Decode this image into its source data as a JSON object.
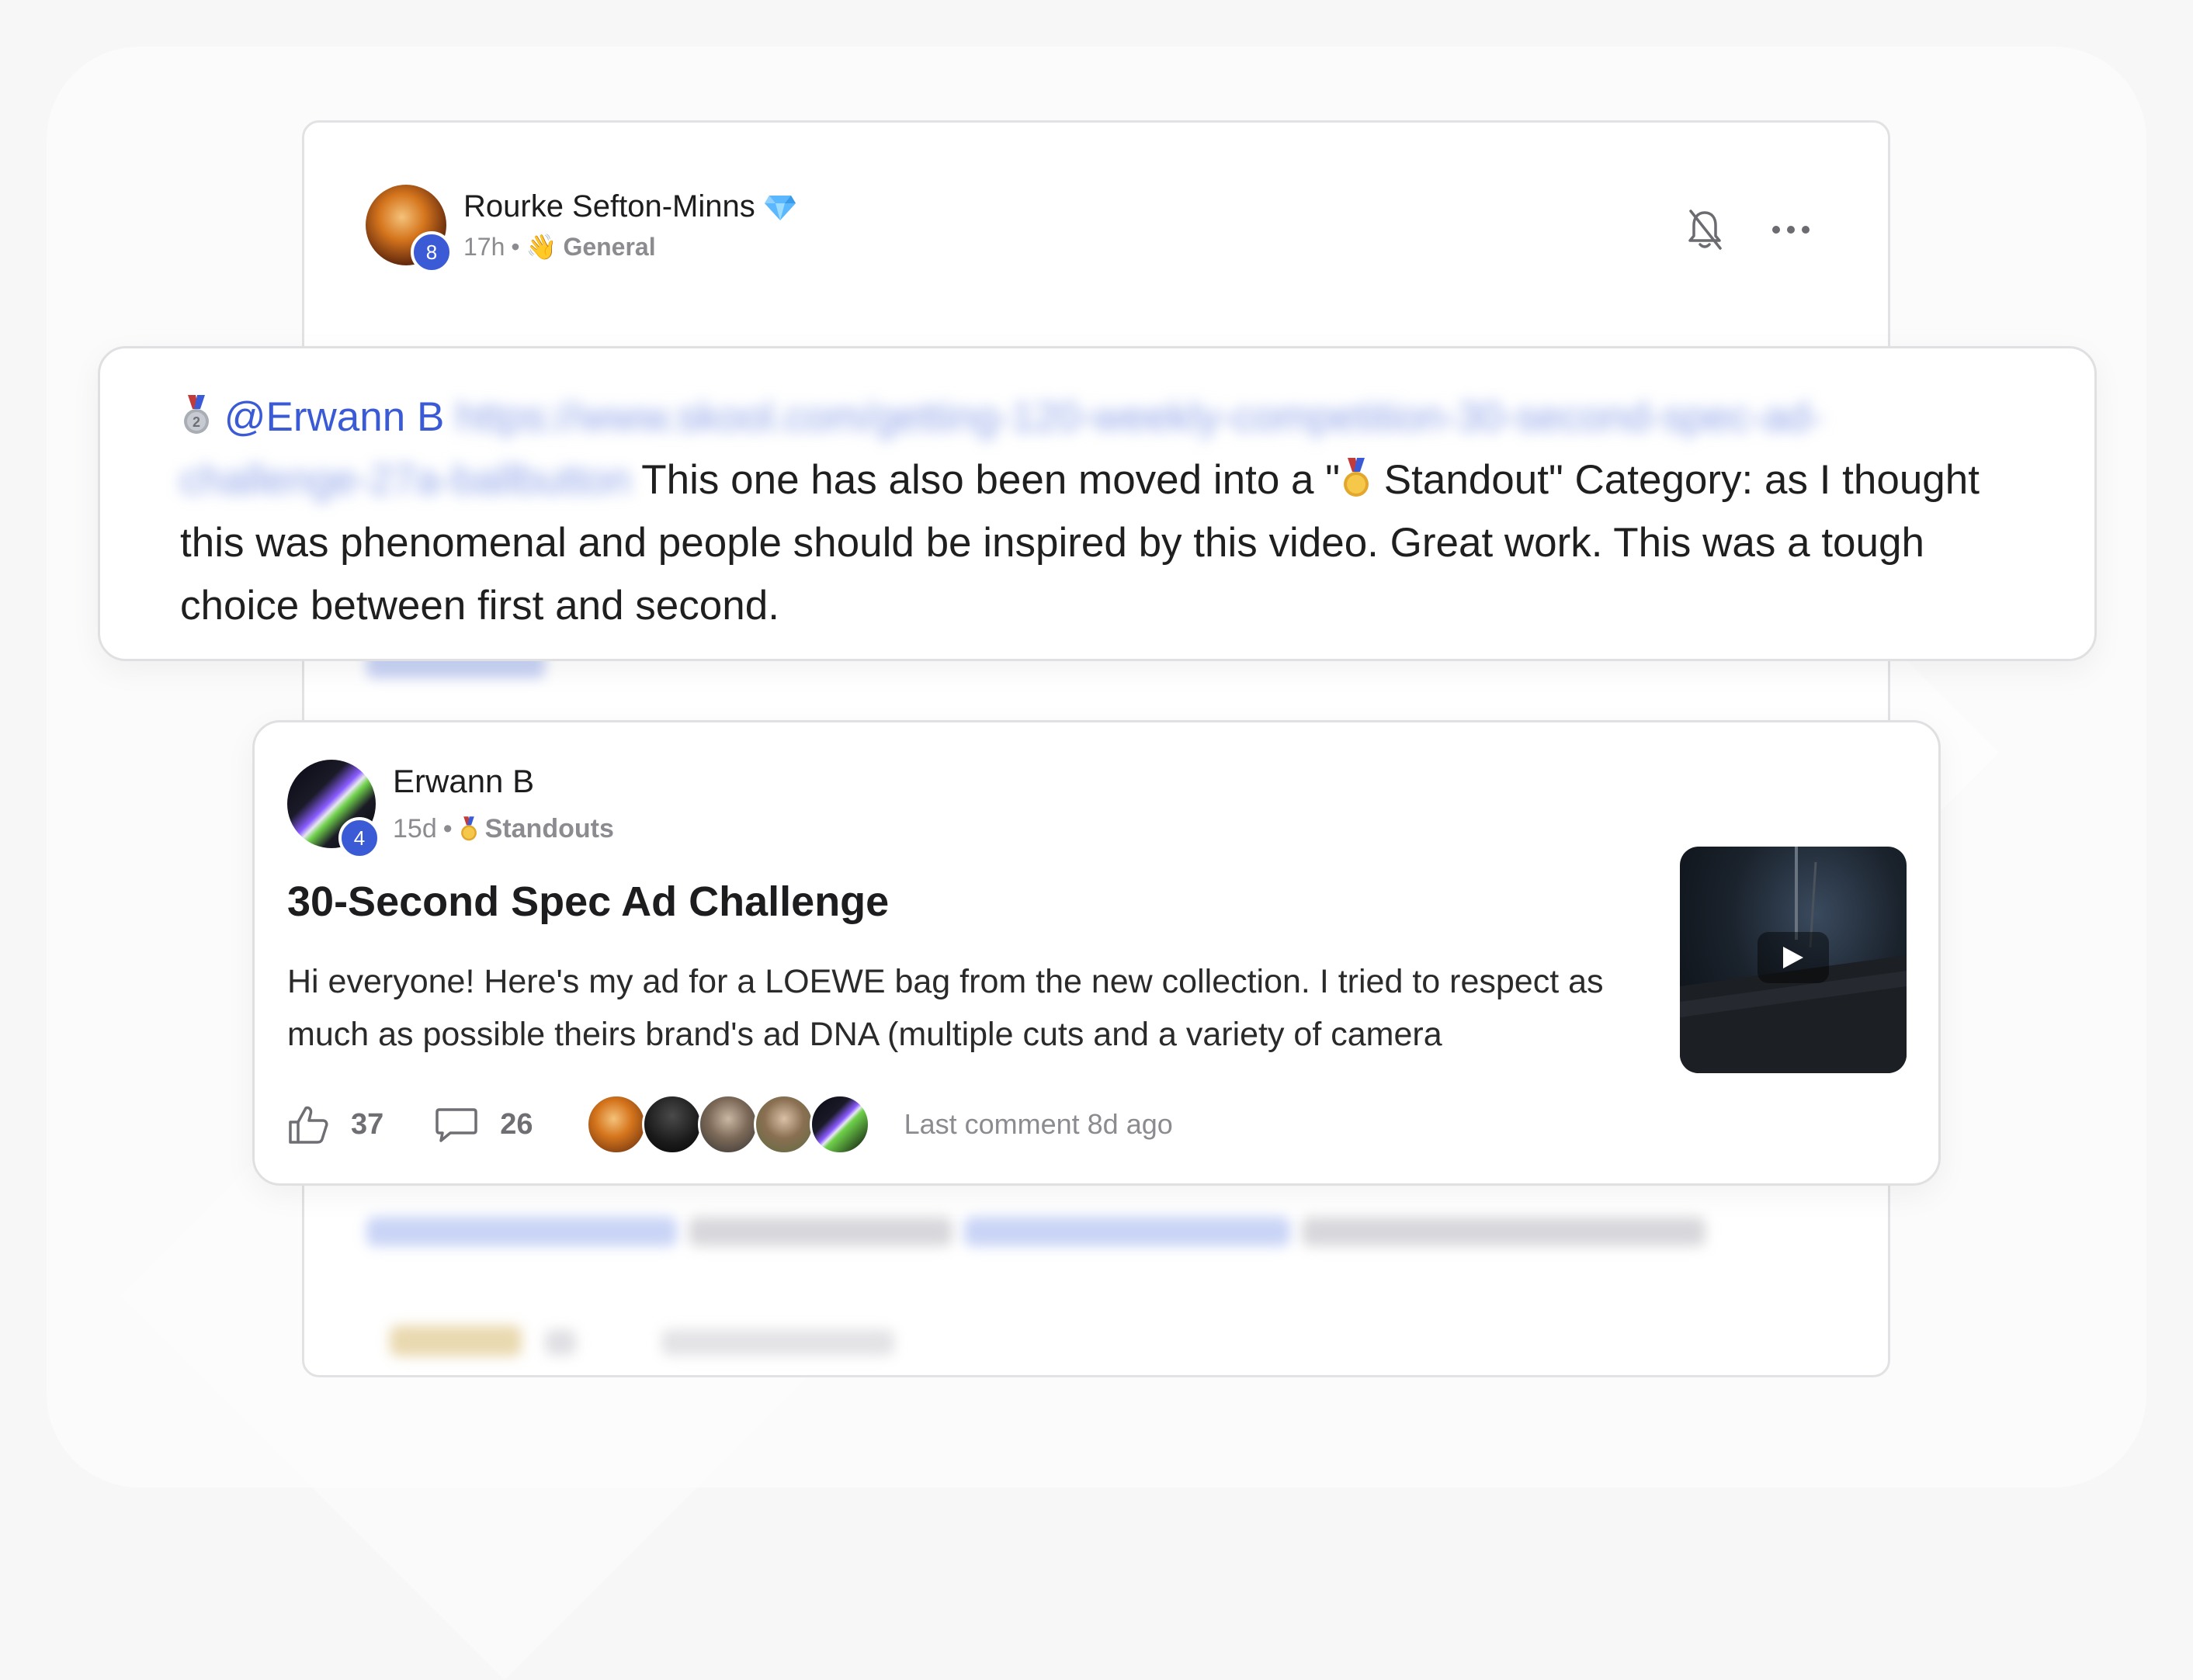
{
  "original_post": {
    "author_name": "Rourke Sefton-Minns",
    "author_level": "8",
    "time": "17h",
    "separator": "•",
    "category": "General",
    "category_emoji": "👋"
  },
  "comment": {
    "mention": "@Erwann B",
    "blurred_link_text": "https://www.skool.com/getting-120-weekly-competition-30-second-spec-ad-challenge-27a-ballbutton",
    "text": "This one has also been moved into a \"",
    "standout_label": "Standout\" Category: as I thought this was phenomenal and people should be inspired by this video. Great work. This was a tough choice between first and second."
  },
  "embedded_post": {
    "author_name": "Erwann B",
    "author_level": "4",
    "time": "15d",
    "separator": "•",
    "category": "Standouts",
    "title": "30-Second Spec Ad Challenge",
    "body": "Hi everyone! Here's my ad for a LOEWE bag from the new collection. I tried to respect as much as possible theirs brand's ad DNA (multiple cuts and a variety of camera",
    "likes": "37",
    "comments": "26",
    "last_comment": "Last comment 8d ago"
  },
  "colors": {
    "accent": "#3b5bd6",
    "muted": "#8b8b90",
    "text": "#1f1f1f"
  }
}
